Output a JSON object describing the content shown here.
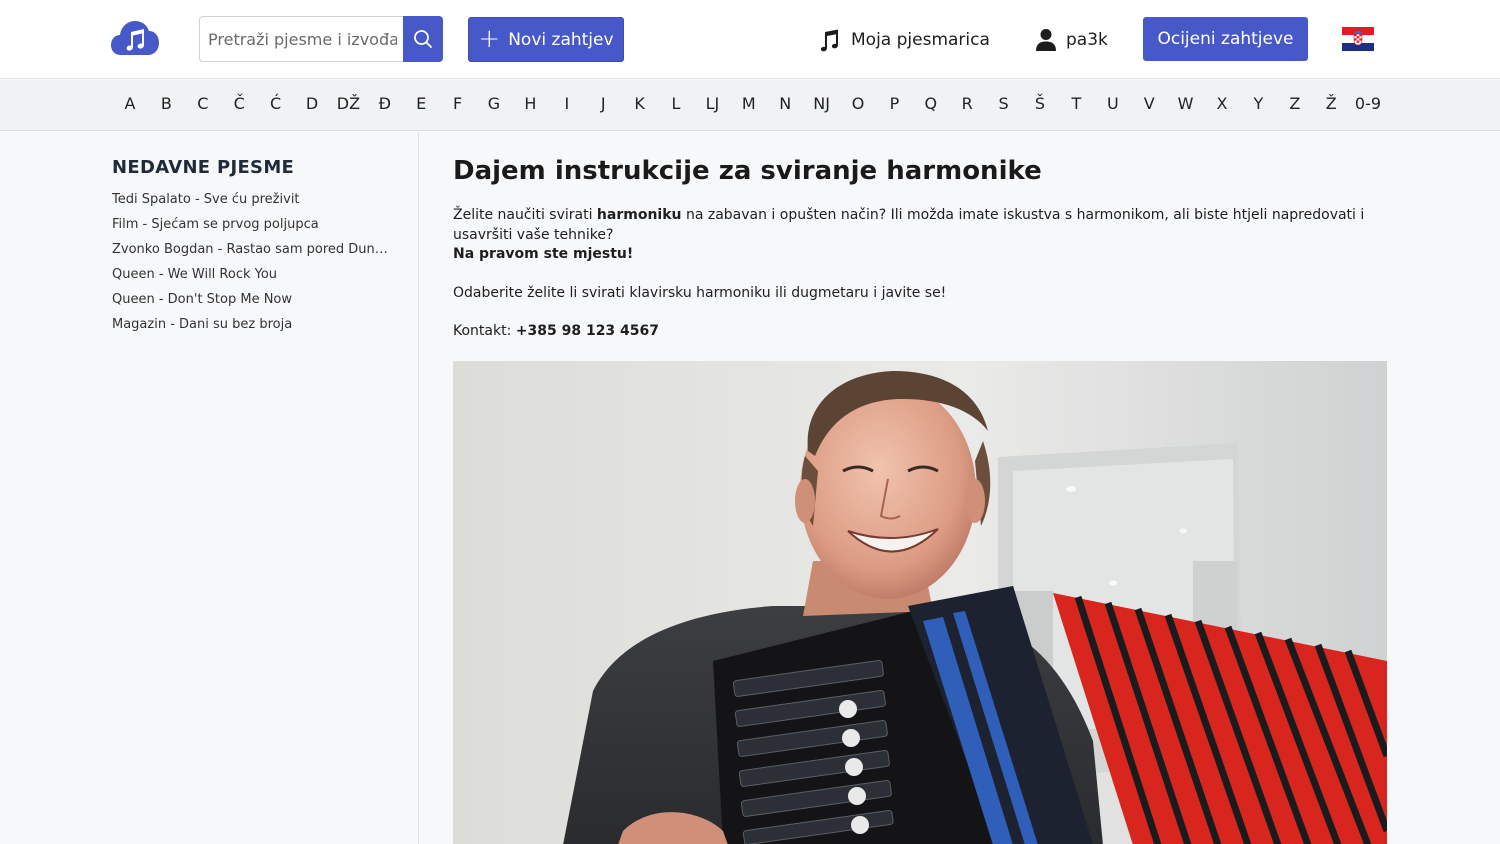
{
  "header": {
    "search_placeholder": "Pretraži pjesme i izvođače",
    "new_request_label": "Novi zahtjev",
    "songbook_label": "Moja pjesmarica",
    "username": "pa3k",
    "rate_requests_label": "Ocijeni zahtjeve",
    "language_flag": "croatia-flag-icon"
  },
  "alphabet": [
    "A",
    "B",
    "C",
    "Č",
    "Ć",
    "D",
    "DŽ",
    "Đ",
    "E",
    "F",
    "G",
    "H",
    "I",
    "J",
    "K",
    "L",
    "LJ",
    "M",
    "N",
    "NJ",
    "O",
    "P",
    "Q",
    "R",
    "S",
    "Š",
    "T",
    "U",
    "V",
    "W",
    "X",
    "Y",
    "Z",
    "Ž",
    "0-9"
  ],
  "sidebar": {
    "title": "NEDAVNE PJESME",
    "recent": [
      "Tedi Spalato - Sve ću preživit",
      "Film - Sjećam se prvog poljupca",
      "Zvonko Bogdan - Rastao sam pored Duna...",
      "Queen - We Will Rock You",
      "Queen - Don't Stop Me Now",
      "Magazin - Dani su bez broja"
    ]
  },
  "main": {
    "title": "Dajem instrukcije za sviranje harmonike",
    "intro_before": "Želite naučiti svirati ",
    "intro_bold": "harmoniku",
    "intro_after": " na zabavan i opušten način? Ili možda imate iskustva s harmonikom, ali biste htjeli napredovati i usavršiti vaše tehnike?",
    "right_place": "Na pravom ste mjestu!",
    "choose_text": "Odaberite želite li svirati klavirsku harmoniku ili dugmetaru i javite se!",
    "contact_label": "Kontakt: ",
    "contact_phone": "+385 98 123 4567"
  },
  "colors": {
    "accent": "#4759c9",
    "accordion_red": "#d8261e"
  }
}
